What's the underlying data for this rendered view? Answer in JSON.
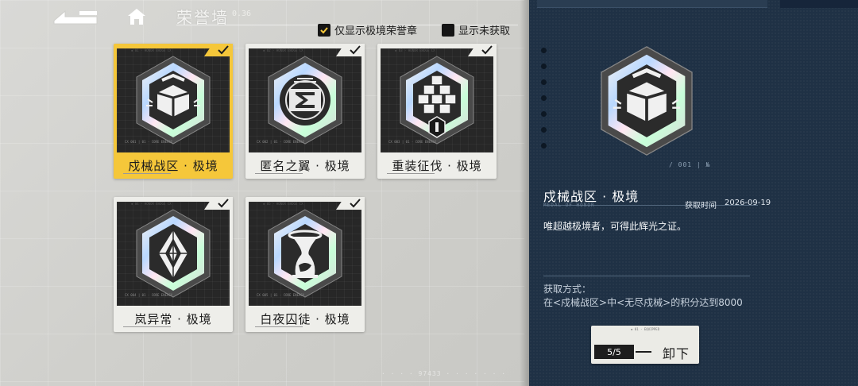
{
  "header": {
    "title": "荣誉墙",
    "code": "0.36"
  },
  "filters": [
    {
      "label": "仅显示极境荣誉章",
      "checked": true
    },
    {
      "label": "显示未获取",
      "checked": false
    }
  ],
  "badges": [
    {
      "label": "戍械战区 · 极境",
      "selected": true,
      "owned": true,
      "icon": "cube-shield-icon"
    },
    {
      "label": "匿名之翼 · 极境",
      "selected": false,
      "owned": true,
      "icon": "sigma-icon"
    },
    {
      "label": "重装征伐 · 极境",
      "selected": false,
      "owned": true,
      "icon": "stacked-cubes-icon"
    },
    {
      "label": "岚异常 · 极境",
      "selected": false,
      "owned": true,
      "icon": "crystal-icon"
    },
    {
      "label": "白夜囚徒 · 极境",
      "selected": false,
      "owned": true,
      "icon": "hourglass-icon"
    }
  ],
  "detail": {
    "title": "戍械战区 · 极境",
    "obtain_time_label": "获取时间",
    "obtain_time": "2026-09-19",
    "description": "唯超越极境者，可得此辉光之证。",
    "method_label": "获取方式：",
    "method_text": "在<戍械战区>中<无尽戍械>的积分达到8000",
    "equip_count": "5/5",
    "unequip_label": "卸下"
  },
  "colors": {
    "selected": "#f5c73a",
    "panel": "#1f3145",
    "card": "#eeeeea"
  }
}
